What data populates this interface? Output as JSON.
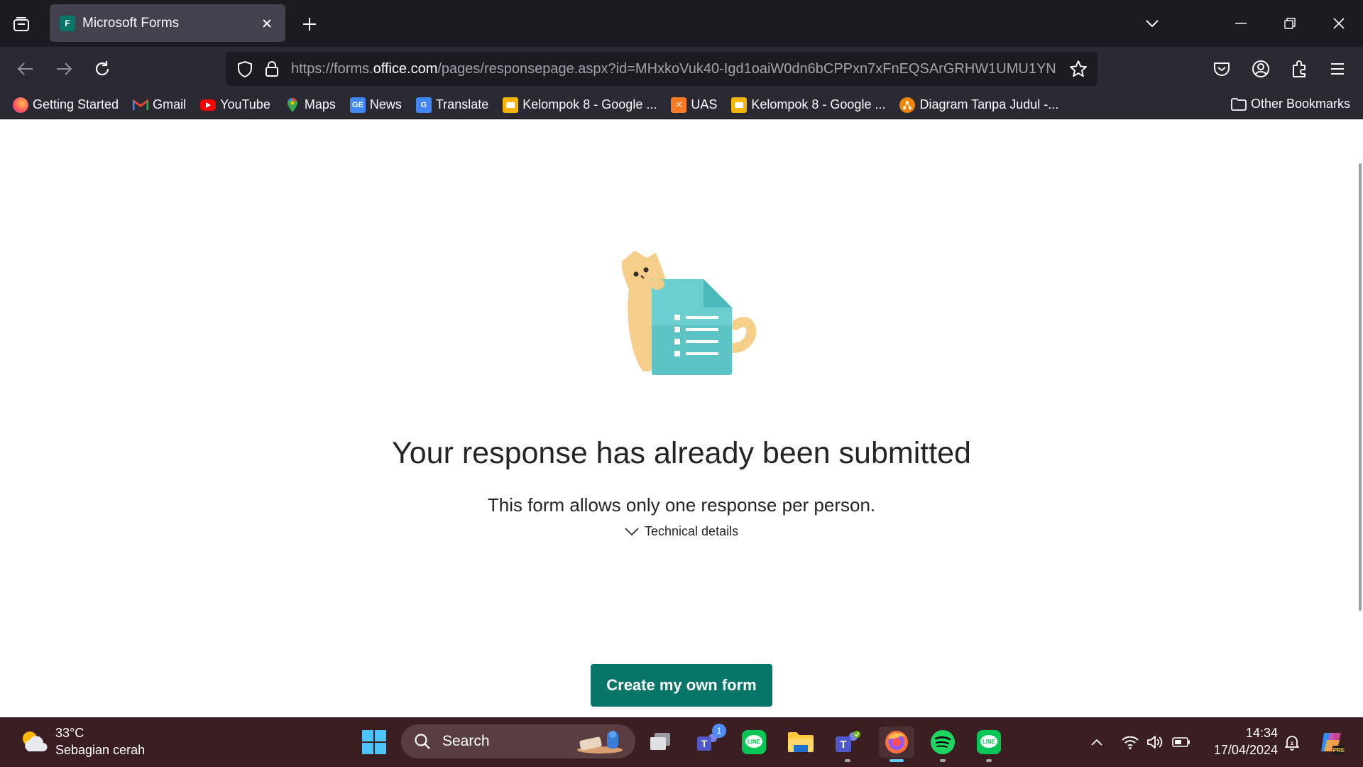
{
  "browser": {
    "tab_title": "Microsoft Forms",
    "tab_favicon_letter": "F",
    "url_prefix": "https://forms.",
    "url_host": "office.com",
    "url_path": "/pages/responsepage.aspx?id=MHxkoVuk40-Igd1oaiW0dn6bCPPxn7xFnEQSArGRHW1UMU1YN"
  },
  "bookmarks": [
    {
      "label": "Getting Started",
      "icon": "firefox-icon",
      "color": "#ff7139"
    },
    {
      "label": "Gmail",
      "icon": "gmail-icon",
      "color": "#ea4335"
    },
    {
      "label": "YouTube",
      "icon": "youtube-icon",
      "color": "#ff0000"
    },
    {
      "label": "Maps",
      "icon": "maps-icon",
      "color": "#34a853"
    },
    {
      "label": "News",
      "icon": "google-news-icon",
      "color": "#4285f4"
    },
    {
      "label": "Translate",
      "icon": "google-translate-icon",
      "color": "#4285f4"
    },
    {
      "label": "Kelompok 8 - Google ...",
      "icon": "google-slides-icon",
      "color": "#f4b400"
    },
    {
      "label": "UAS",
      "icon": "xampp-icon",
      "color": "#fb7a24"
    },
    {
      "label": "Kelompok 8 - Google ...",
      "icon": "google-slides-icon",
      "color": "#f4b400"
    },
    {
      "label": "Diagram Tanpa Judul -...",
      "icon": "drawio-icon",
      "color": "#f08705"
    }
  ],
  "other_bookmarks_label": "Other Bookmarks",
  "page": {
    "headline": "Your response has already been submitted",
    "subline": "This form allows only one response per person.",
    "technical_details_label": "Technical details",
    "create_button_label": "Create my own form",
    "accent_color": "#077568"
  },
  "taskbar": {
    "weather_temp": "33°C",
    "weather_desc": "Sebagian cerah",
    "search_label": "Search",
    "teams_badge": "1",
    "clock_time": "14:34",
    "clock_date": "17/04/2024"
  }
}
